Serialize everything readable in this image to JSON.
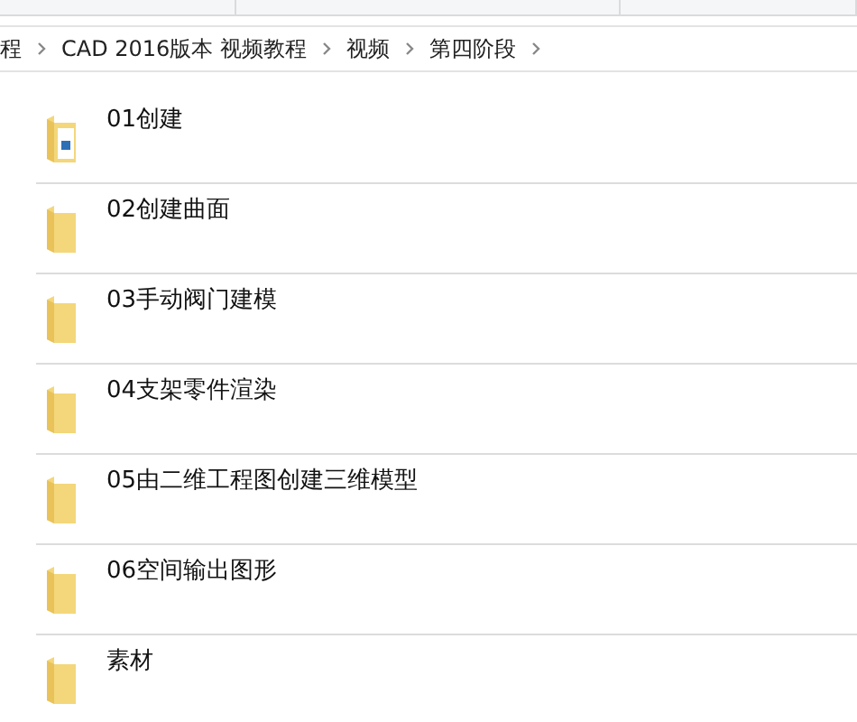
{
  "breadcrumb": [
    {
      "label": "程"
    },
    {
      "label": "CAD 2016版本 视频教程"
    },
    {
      "label": "视频"
    },
    {
      "label": "第四阶段"
    }
  ],
  "items": [
    {
      "name": "01创建",
      "kind": "folder-with-files"
    },
    {
      "name": "02创建曲面",
      "kind": "folder"
    },
    {
      "name": "03手动阀门建模",
      "kind": "folder"
    },
    {
      "name": "04支架零件渲染",
      "kind": "folder"
    },
    {
      "name": "05由二维工程图创建三维模型",
      "kind": "folder"
    },
    {
      "name": "06空间输出图形",
      "kind": "folder"
    },
    {
      "name": "素材",
      "kind": "folder"
    }
  ]
}
